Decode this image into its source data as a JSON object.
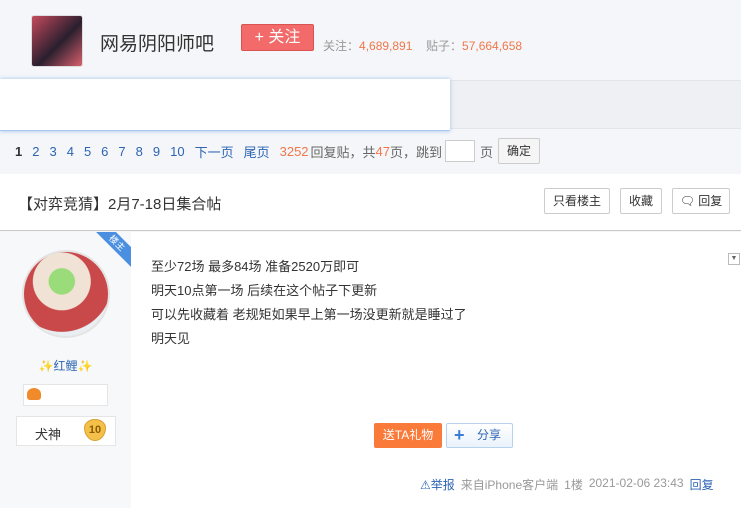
{
  "forum": {
    "name": "网易阴阳师吧",
    "follow_label": "+ 关注",
    "followers_label": "关注：",
    "followers": "4,689,891",
    "posts_label": "贴子：",
    "posts": "57,664,658"
  },
  "pager": {
    "current": "1",
    "pages": [
      "2",
      "3",
      "4",
      "5",
      "6",
      "7",
      "8",
      "9",
      "10"
    ],
    "next": "下一页",
    "last": "尾页",
    "reply_count": "3252",
    "reply_text": "回复贴，共",
    "total_pages": "47",
    "pages_text": "页，跳到",
    "page_unit": "页",
    "confirm": "确定"
  },
  "thread": {
    "title": "【对弈竞猜】2月7-18日集合帖",
    "only_op": "只看楼主",
    "favorite": "收藏",
    "reply": "回复"
  },
  "post": {
    "op_tag": "楼主",
    "username": "✨红鲤✨",
    "level_name": "犬神",
    "level": "10",
    "lines": [
      "至少72场 最多84场 准备2520万即可",
      "明天10点第一场 后续在这个帖子下更新",
      "可以先收藏着 老规矩如果早上第一场没更新就是睡过了",
      "明天见"
    ],
    "gift": "送TA礼物",
    "share": "分享",
    "report": "⚠举报",
    "source": "来自iPhone客户端",
    "floor": "1楼",
    "time": "2021-02-06 23:43",
    "reply": "回复"
  }
}
